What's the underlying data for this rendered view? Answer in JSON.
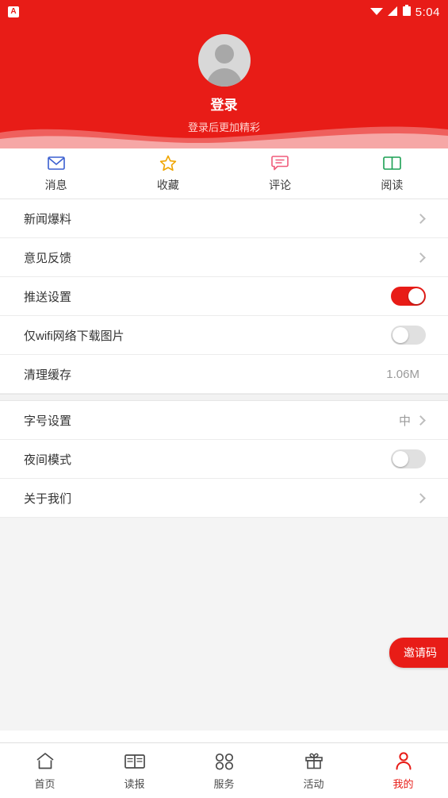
{
  "statusbar": {
    "app_badge": "A",
    "time": "5:04",
    "icons": [
      "wifi-icon",
      "signal-icon",
      "battery-icon"
    ]
  },
  "header": {
    "avatar": "default-avatar",
    "login_label": "登录",
    "login_subtitle": "登录后更加精彩",
    "background_color": "#e81c17"
  },
  "quick_tabs": [
    {
      "icon": "envelope-icon",
      "label": "消息",
      "color": "#3a5fd0"
    },
    {
      "icon": "star-icon",
      "label": "收藏",
      "color": "#f0a500"
    },
    {
      "icon": "comment-icon",
      "label": "评论",
      "color": "#f05a7a"
    },
    {
      "icon": "book-icon",
      "label": "阅读",
      "color": "#1aa053"
    }
  ],
  "settings_group_1": [
    {
      "label": "新闻爆料",
      "type": "chevron",
      "value": ""
    },
    {
      "label": "意见反馈",
      "type": "chevron",
      "value": ""
    },
    {
      "label": "推送设置",
      "type": "toggle",
      "state": "on"
    },
    {
      "label": "仅wifi网络下载图片",
      "type": "toggle",
      "state": "off"
    },
    {
      "label": "清理缓存",
      "type": "value",
      "value": "1.06M"
    }
  ],
  "settings_group_2": [
    {
      "label": "字号设置",
      "type": "value-chevron",
      "value": "中"
    },
    {
      "label": "夜间模式",
      "type": "toggle",
      "state": "off"
    },
    {
      "label": "关于我们",
      "type": "chevron",
      "value": ""
    }
  ],
  "invite": {
    "label": "邀请码"
  },
  "bottom_nav": [
    {
      "icon": "home-icon",
      "label": "首页",
      "active": false
    },
    {
      "icon": "newspaper-icon",
      "label": "读报",
      "active": false
    },
    {
      "icon": "grid-icon",
      "label": "服务",
      "active": false
    },
    {
      "icon": "gift-icon",
      "label": "活动",
      "active": false
    },
    {
      "icon": "person-icon",
      "label": "我的",
      "active": true
    }
  ],
  "accent_color": "#e81c17"
}
